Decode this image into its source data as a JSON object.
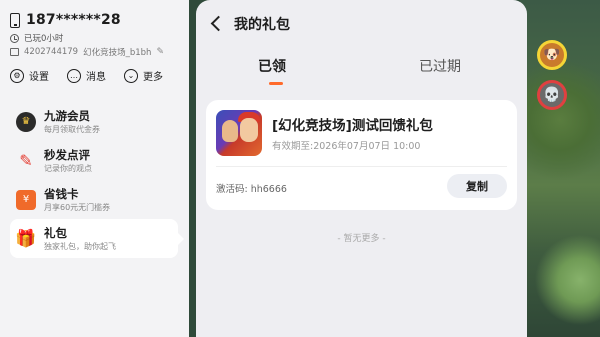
{
  "user": {
    "phone": "187******28",
    "play_time": "已玩0小时",
    "id_text": "4202744179",
    "nickname": "幻化竞技场_b1bh"
  },
  "actions": [
    {
      "label": "设置",
      "icon": "gear-icon"
    },
    {
      "label": "消息",
      "icon": "message-icon"
    },
    {
      "label": "更多",
      "icon": "chevron-down-icon"
    }
  ],
  "menu": [
    {
      "title": "九游会员",
      "sub": "每月领取代金券",
      "icon": "crown-icon"
    },
    {
      "title": "秒发点评",
      "sub": "记录你的观点",
      "icon": "pen-icon"
    },
    {
      "title": "省钱卡",
      "sub": "月享60元无门槛券",
      "icon": "card-icon"
    },
    {
      "title": "礼包",
      "sub": "独家礼包，助你起飞",
      "icon": "gift-icon",
      "active": true
    }
  ],
  "page": {
    "title": "我的礼包",
    "tabs": [
      {
        "label": "已领",
        "active": true
      },
      {
        "label": "已过期",
        "active": false
      }
    ]
  },
  "gift": {
    "title": "[幻化竞技场]测试回馈礼包",
    "expire": "有效期至:2026年07月07日 10:00",
    "code": "激活码: hh6666",
    "copy_label": "复制"
  },
  "footer": {
    "no_more": "- 暂无更多 -"
  },
  "colors": {
    "accent": "#ff6a2b",
    "sidebar_bg": "#f3f3f5",
    "panel_bg": "#eeeef2"
  }
}
